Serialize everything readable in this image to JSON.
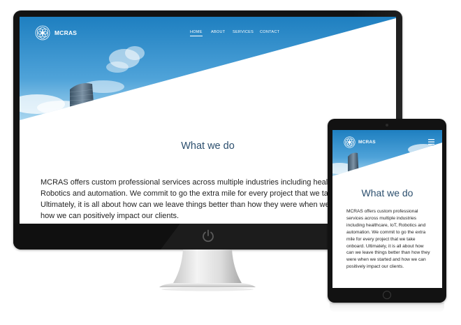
{
  "desktop": {
    "logo_text": "MCRAS",
    "nav": [
      {
        "label": "HOME",
        "active": true
      },
      {
        "label": "ABOUT",
        "active": false
      },
      {
        "label": "SERVICES",
        "active": false
      },
      {
        "label": "CONTACT",
        "active": false
      }
    ],
    "section_title": "What we do",
    "paragraph_lines": [
      "MCRAS offers custom professional services across multiple industries including healthc",
      "Robotics and automation. We commit to go the extra mile for every project that we take",
      "Ultimately, it is all about how can we leave things better than how they were when we s",
      "how we can positively impact our clients."
    ]
  },
  "tablet": {
    "logo_text": "MCRAS",
    "section_title": "What we do",
    "paragraph": "MCRAS offers custom professional services across multiple industries including healthcare, IoT, Robotics and automation. We commit to go the extra mile for every project that we take onboard. Ultimately, it is all about how can we leave things better than how they were when we started and how we can positively impact our clients."
  },
  "colors": {
    "sky_top": "#1e7fc0",
    "sky_bottom": "#86c4e6",
    "title_blue": "#2c4f6e",
    "bezel": "#121212"
  },
  "icons": {
    "logo": "flower-of-life-icon",
    "menu": "hamburger-menu-icon",
    "power": "power-icon",
    "home_button": "home-button-icon"
  }
}
